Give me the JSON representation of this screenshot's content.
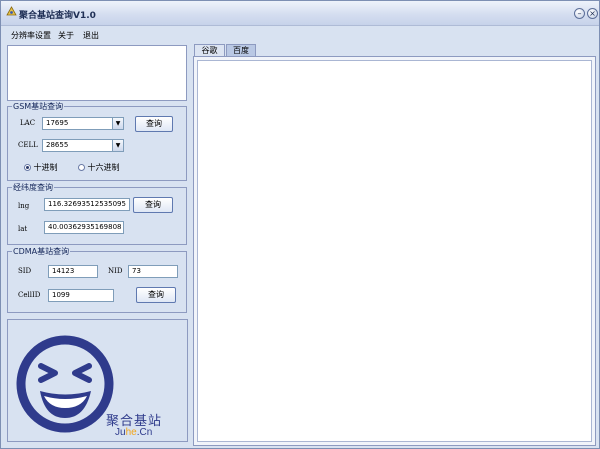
{
  "window": {
    "title": "聚合基站查询V1.0",
    "minimize": "–",
    "close": "×"
  },
  "menu": [
    "分辨率设置",
    "关于",
    "退出"
  ],
  "gsm": {
    "title": "GSM基站查询",
    "lac_label": "LAC",
    "lac_value": "17695",
    "cell_label": "CELL",
    "cell_value": "28655",
    "query": "查询",
    "radio_dec": "十进制",
    "radio_hex": "十六进制",
    "selected": "dec"
  },
  "geo": {
    "title": "经纬度查询",
    "lng_label": "lng",
    "lng_value": "116.32693512535095",
    "lat_label": "lat",
    "lat_value": "40.00362935169808",
    "query": "查询"
  },
  "cdma": {
    "title": "CDMA基站查询",
    "sid_label": "SID",
    "sid_value": "14123",
    "nid_label": "NID",
    "nid_value": "73",
    "cellid_label": "CellID",
    "cellid_value": "1099",
    "query": "查询"
  },
  "logo": {
    "text": "聚合基站",
    "site_a": "Ju",
    "site_b": "he",
    "site_c": ".Cn",
    "color": "#2f3b8c",
    "accent": "#f2a51a"
  },
  "tabs": [
    {
      "label": "谷歌",
      "active": false
    },
    {
      "label": "百度",
      "active": true
    }
  ]
}
